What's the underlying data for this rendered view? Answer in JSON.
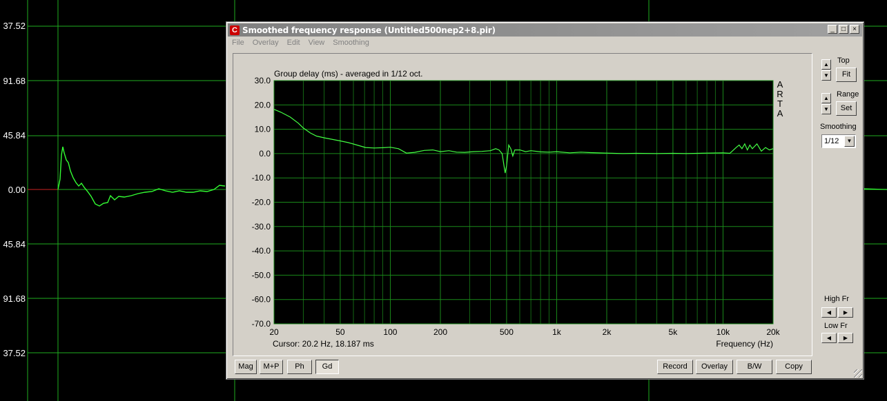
{
  "background": {
    "y_labels": [
      "37.52",
      "91.68",
      "45.84",
      "0.00",
      "45.84",
      "91.68",
      "37.52"
    ],
    "colors": {
      "grid": "#1fae1f",
      "trace": "#33ff33",
      "zero": "#cc2222"
    }
  },
  "window": {
    "title": "Smoothed frequency response (Untitled500nep2+8.pir)",
    "icon": "app-logo-icon",
    "controls": {
      "minimize": "_",
      "maximize": "□",
      "close": "×"
    }
  },
  "menu": [
    "File",
    "Overlay",
    "Edit",
    "View",
    "Smoothing"
  ],
  "plot": {
    "cursor_text": "Cursor: 20.2 Hz, 18.187 ms",
    "watermark": [
      "A",
      "R",
      "T",
      "A"
    ]
  },
  "chart_data": {
    "type": "line",
    "title": "Group delay (ms) - averaged in 1/12 oct.",
    "xlabel": "Frequency (Hz)",
    "ylabel": "",
    "x_scale": "log",
    "xlim": [
      20,
      20000
    ],
    "ylim": [
      -70,
      30
    ],
    "x_ticks": [
      20,
      50,
      100,
      200,
      500,
      1000,
      2000,
      5000,
      10000,
      20000
    ],
    "x_tick_labels": [
      "20",
      "50",
      "100",
      "200",
      "500",
      "1k",
      "2k",
      "5k",
      "10k",
      "20k"
    ],
    "y_ticks": [
      30,
      20,
      10,
      0,
      -10,
      -20,
      -30,
      -40,
      -50,
      -60,
      -70
    ],
    "y_tick_labels": [
      "30.0",
      "20.0",
      "10.0",
      "0.0",
      "-10.0",
      "-20.0",
      "-30.0",
      "-40.0",
      "-50.0",
      "-60.0",
      "-70.0"
    ],
    "grid": true,
    "colors": {
      "grid": "#1a8a1a",
      "line": "#44ff44",
      "axis_text": "#000000"
    },
    "series": [
      {
        "x": [
          20,
          22,
          25,
          28,
          30,
          33,
          36,
          40,
          45,
          50,
          56,
          63,
          71,
          80,
          90,
          100,
          112,
          125,
          140,
          160,
          180,
          200,
          225,
          250,
          280,
          315,
          355,
          400,
          430,
          450,
          470,
          480,
          490,
          500,
          515,
          530,
          545,
          560,
          600,
          650,
          700,
          800,
          900,
          1000,
          1200,
          1400,
          1600,
          2000,
          2500,
          3000,
          4000,
          5000,
          6000,
          8000,
          10000,
          11000,
          12000,
          12500,
          13000,
          13500,
          14000,
          14500,
          15000,
          16000,
          17000,
          18000,
          19000,
          20000
        ],
        "y": [
          18.2,
          17.0,
          15.0,
          12.5,
          10.5,
          8.5,
          7.2,
          6.5,
          5.8,
          5.2,
          4.5,
          3.5,
          2.5,
          2.3,
          2.4,
          2.6,
          2.0,
          0.2,
          0.5,
          1.3,
          1.5,
          0.8,
          1.2,
          0.6,
          0.5,
          0.8,
          0.9,
          1.2,
          2.0,
          1.5,
          0.0,
          -4.0,
          -8.0,
          -5.0,
          3.5,
          2.0,
          -1.0,
          1.5,
          1.5,
          0.8,
          1.2,
          0.7,
          0.6,
          0.8,
          0.3,
          0.6,
          0.4,
          0.2,
          0.0,
          0.1,
          0.0,
          0.1,
          0.0,
          0.2,
          0.3,
          0.1,
          2.5,
          3.5,
          2.0,
          4.0,
          1.5,
          3.5,
          2.0,
          4.0,
          1.0,
          2.5,
          1.5,
          2.0
        ]
      }
    ]
  },
  "right_panel": {
    "top_label": "Top",
    "fit_label": "Fit",
    "range_label": "Range",
    "set_label": "Set",
    "smoothing_label": "Smoothing",
    "smoothing_value": "1/12",
    "high_fr_label": "High Fr",
    "low_fr_label": "Low Fr"
  },
  "bottom_buttons": {
    "left": [
      "Mag",
      "M+P",
      "Ph",
      "Gd"
    ],
    "active": "Gd",
    "right": [
      "Record",
      "Overlay",
      "B/W",
      "Copy"
    ]
  }
}
